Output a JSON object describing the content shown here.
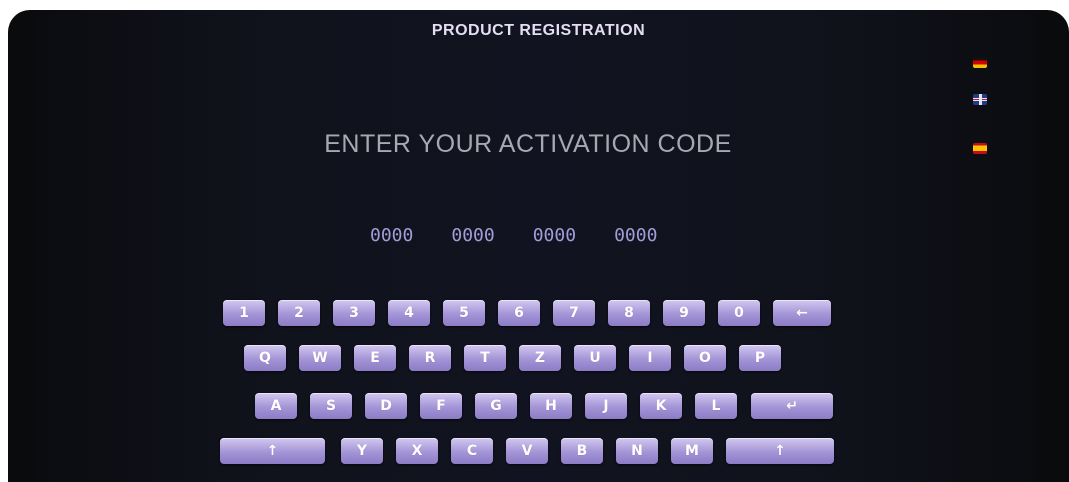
{
  "header": {
    "title": "PRODUCT REGISTRATION"
  },
  "prompt": "ENTER YOUR ACTIVATION CODE",
  "activation_code": {
    "groups": [
      "0000",
      "0000",
      "0000",
      "0000"
    ]
  },
  "languages": [
    {
      "name": "german-flag-icon"
    },
    {
      "name": "uk-flag-icon"
    },
    {
      "name": "spanish-flag-icon"
    }
  ],
  "keyboard": {
    "row1": [
      "1",
      "2",
      "3",
      "4",
      "5",
      "6",
      "7",
      "8",
      "9",
      "0"
    ],
    "backspace_label": "←",
    "row2": [
      "Q",
      "W",
      "E",
      "R",
      "T",
      "Z",
      "U",
      "I",
      "O",
      "P"
    ],
    "row3": [
      "A",
      "S",
      "D",
      "F",
      "G",
      "H",
      "J",
      "K",
      "L"
    ],
    "enter_label": "↵",
    "row4": [
      "Y",
      "X",
      "C",
      "V",
      "B",
      "N",
      "M"
    ],
    "shift_label": "↑"
  }
}
